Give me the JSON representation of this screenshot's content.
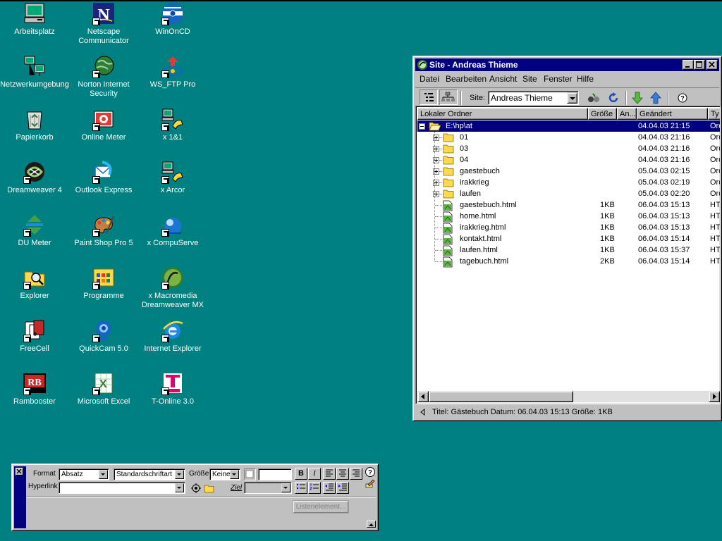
{
  "colors": {
    "desktop": "#008080",
    "titlebar": "#000080",
    "face": "#c0c0c0"
  },
  "desktop_icons": [
    {
      "label": "Arbeitsplatz",
      "icon": "computer-icon"
    },
    {
      "label": "Netscape\nCommunicator",
      "icon": "netscape-icon"
    },
    {
      "label": "WinOnCD",
      "icon": "cd-icon"
    },
    {
      "label": "Netzwerkumgebung",
      "icon": "network-icon"
    },
    {
      "label": "Norton Internet\nSecurity",
      "icon": "globe-icon"
    },
    {
      "label": "WS_FTP Pro",
      "icon": "ftp-icon"
    },
    {
      "label": "Papierkorb",
      "icon": "recycle-bin-icon"
    },
    {
      "label": "Online Meter",
      "icon": "phone-icon"
    },
    {
      "label": "x 1&1",
      "icon": "dialup-icon"
    },
    {
      "label": "Dreamweaver 4",
      "icon": "dreamweaver-icon"
    },
    {
      "label": "Outlook Express",
      "icon": "outlook-icon"
    },
    {
      "label": "x Arcor",
      "icon": "dialup-icon"
    },
    {
      "label": "DU Meter",
      "icon": "du-meter-icon"
    },
    {
      "label": "Paint Shop Pro 5",
      "icon": "palette-icon"
    },
    {
      "label": "x CompuServe",
      "icon": "compuserve-icon"
    },
    {
      "label": "Explorer",
      "icon": "folder-search-icon"
    },
    {
      "label": "Programme",
      "icon": "programs-icon"
    },
    {
      "label": "x Macromedia\nDreamweaver MX",
      "icon": "dreamweaver-mx-icon"
    },
    {
      "label": "FreeCell",
      "icon": "cards-icon"
    },
    {
      "label": "QuickCam 5.0",
      "icon": "webcam-icon"
    },
    {
      "label": "Internet Explorer",
      "icon": "ie-icon"
    },
    {
      "label": "Rambooster",
      "icon": "rambooster-icon"
    },
    {
      "label": "Microsoft Excel",
      "icon": "excel-icon"
    },
    {
      "label": "T-Online 3.0",
      "icon": "t-online-icon"
    }
  ],
  "site_window": {
    "title": "Site - Andreas Thieme",
    "menu": [
      "Datei",
      "Bearbeiten",
      "Ansicht",
      "Site",
      "Fenster",
      "Hilfe"
    ],
    "menu_mnemonic": [
      "D",
      "B",
      "A",
      "S",
      "F",
      "H"
    ],
    "site_label": "Site:",
    "site_value": "Andreas Thieme",
    "columns": [
      "Lokaler Ordner",
      "Größe",
      "An...",
      "Geändert",
      "Ty"
    ],
    "rows": [
      {
        "name": "E:\\hp\\at",
        "size": "",
        "modified": "04.04.03 21:15",
        "type": "Ord",
        "kind": "root",
        "expander": "-"
      },
      {
        "name": "01",
        "size": "",
        "modified": "04.04.03 21:16",
        "type": "Ord",
        "kind": "folder",
        "expander": "+"
      },
      {
        "name": "03",
        "size": "",
        "modified": "04.04.03 21:16",
        "type": "Ord",
        "kind": "folder",
        "expander": "+"
      },
      {
        "name": "04",
        "size": "",
        "modified": "04.04.03 21:16",
        "type": "Ord",
        "kind": "folder",
        "expander": "+"
      },
      {
        "name": "gaestebuch",
        "size": "",
        "modified": "05.04.03 02:15",
        "type": "Ord",
        "kind": "folder",
        "expander": "+"
      },
      {
        "name": "irakkrieg",
        "size": "",
        "modified": "05.04.03 02:19",
        "type": "Ord",
        "kind": "folder",
        "expander": "+"
      },
      {
        "name": "laufen",
        "size": "",
        "modified": "05.04.03 02:20",
        "type": "Ord",
        "kind": "folder",
        "expander": "+"
      },
      {
        "name": "gaestebuch.html",
        "size": "1KB",
        "modified": "06.04.03 15:13",
        "type": "HT",
        "kind": "file",
        "expander": ""
      },
      {
        "name": "home.html",
        "size": "1KB",
        "modified": "06.04.03 15:13",
        "type": "HT",
        "kind": "file",
        "expander": ""
      },
      {
        "name": "irakkrieg.html",
        "size": "1KB",
        "modified": "06.04.03 15:13",
        "type": "HT",
        "kind": "file",
        "expander": ""
      },
      {
        "name": "kontakt.html",
        "size": "1KB",
        "modified": "06.04.03 15:14",
        "type": "HT",
        "kind": "file",
        "expander": ""
      },
      {
        "name": "laufen.html",
        "size": "1KB",
        "modified": "06.04.03 15:37",
        "type": "HT",
        "kind": "file",
        "expander": ""
      },
      {
        "name": "tagebuch.html",
        "size": "2KB",
        "modified": "06.04.03 15:14",
        "type": "HT",
        "kind": "file",
        "expander": ""
      }
    ],
    "status": "Titel: Gästebuch  Datum: 06.04.03 15:13  Größe: 1KB"
  },
  "properties": {
    "format_label": "Format",
    "format_value": "Absatz",
    "font_value": "Standardschriftart",
    "size_label": "Größe",
    "size_value": "Keine",
    "hyperlink_label": "Hyperlink",
    "target_label": "Ziel",
    "list_button": "Listenelement...",
    "bold": "B",
    "italic": "I"
  }
}
